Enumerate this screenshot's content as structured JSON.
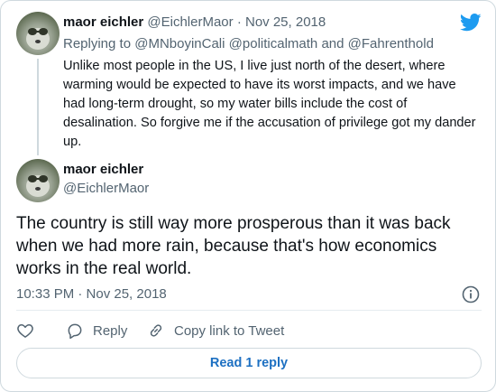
{
  "parent": {
    "name": "maor eichler",
    "handle": "@EichlerMaor",
    "separator": "·",
    "date": "Nov 25, 2018",
    "replying_prefix": "Replying to",
    "mentions": [
      "@MNboyinCali",
      "@politicalmath",
      "@Fahrenthold"
    ],
    "mention_joiner": "and",
    "text": "Unlike most people in the US, I live just north of the desert, where warming would be expected to have its worst impacts, and we have had long-term drought, so my water bills include the cost of desalination.  So forgive me if the accusation of privilege got my dander up."
  },
  "tweet": {
    "name": "maor eichler",
    "handle": "@EichlerMaor",
    "text": "The country is still way more prosperous than it was back when we had more rain, because that's how economics works in the real world.",
    "timestamp": "10:33 PM · Nov 25, 2018"
  },
  "actions": {
    "like_icon": "heart-icon",
    "reply_label": "Reply",
    "reply_icon": "speech-bubble-icon",
    "copy_label": "Copy link to Tweet",
    "copy_icon": "link-icon"
  },
  "read_replies_label": "Read 1 reply",
  "colors": {
    "brand": "#1d9bf0",
    "link": "#1d70c2",
    "text": "#0f1419",
    "muted": "#536471",
    "border": "#cfd9de"
  }
}
